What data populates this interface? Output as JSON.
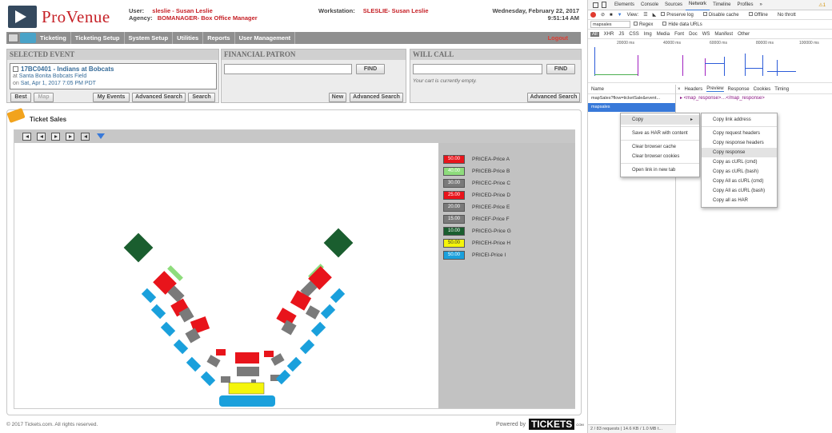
{
  "app": {
    "logo_text": "ProVenue",
    "user_label": "User:",
    "user_value": "sleslie - Susan Leslie",
    "agency_label": "Agency:",
    "agency_value": "BOMANAGER- Box Office Manager",
    "workstation_label": "Workstation:",
    "workstation_value": "SLESLIE- Susan Leslie",
    "date": "Wednesday, February 22, 2017",
    "time": "9:51:14 AM"
  },
  "menu": {
    "items": [
      "Ticketing",
      "Ticketing Setup",
      "System Setup",
      "Utilities",
      "Reports",
      "User Management"
    ],
    "logout": "Logout"
  },
  "selected_event": {
    "title": "SELECTED EVENT",
    "event_line": "17BC0401 - Indians at Bobcats",
    "at_prefix": "at",
    "venue": "Santa Bonita Bobcats Field",
    "on_prefix": "on",
    "datetime": "Sat, Apr 1, 2017 7:05 PM PDT",
    "buttons": [
      "Best",
      "Map",
      "My Events",
      "Advanced Search",
      "Search"
    ]
  },
  "financial_patron": {
    "title": "FINANCIAL PATRON",
    "find": "FIND",
    "new": "New",
    "advanced": "Advanced Search"
  },
  "will_call": {
    "title": "WILL CALL",
    "find": "FIND",
    "cart": "Your cart is currently empty.",
    "advanced": "Advanced Search"
  },
  "ticket_sales": {
    "title": "Ticket Sales",
    "legend": [
      {
        "price": "50.00",
        "label": "PRICEA-Price A",
        "color": "#e8141b"
      },
      {
        "price": "40.00",
        "label": "PRICEB-Price B",
        "color": "#8edc7c"
      },
      {
        "price": "30.00",
        "label": "PRICEC-Price C",
        "color": "#7a7a7a"
      },
      {
        "price": "25.00",
        "label": "PRICED-Price D",
        "color": "#e8141b"
      },
      {
        "price": "20.00",
        "label": "PRICEE-Price E",
        "color": "#7a7a7a"
      },
      {
        "price": "15.00",
        "label": "PRICEF-Price F",
        "color": "#7a7a7a"
      },
      {
        "price": "10.00",
        "label": "PRICEG-Price G",
        "color": "#1a5e2f"
      },
      {
        "price": "50.00",
        "label": "PRICEH-Price H",
        "color": "#f5f50a"
      },
      {
        "price": "50.00",
        "label": "PRICEI-Price I",
        "color": "#1aa0dc"
      }
    ]
  },
  "footer": {
    "copyright": "© 2017 Tickets.com. All rights reserved.",
    "powered_by": "Powered by",
    "brand": "TICKETS",
    "brand_sub": ".COM"
  },
  "devtools": {
    "tabs": [
      "Elements",
      "Console",
      "Sources",
      "Network",
      "Timeline",
      "Profiles",
      "»"
    ],
    "warn": "⚠1",
    "view_label": "View:",
    "preserve_log": "Preserve log",
    "disable_cache": "Disable cache",
    "offline": "Offline",
    "throttle": "No thrott",
    "filter_value": "mapsales",
    "regex": "Regex",
    "hide_data": "Hide data URLs",
    "types": [
      "All",
      "XHR",
      "JS",
      "CSS",
      "Img",
      "Media",
      "Font",
      "Doc",
      "WS",
      "Manifest",
      "Other"
    ],
    "timeline_labels": [
      "20000 ms",
      "40000 ms",
      "60000 ms",
      "80000 ms",
      "100000 ms"
    ],
    "name_header": "Name",
    "requests": [
      "mapSales?flow=ticketSale&event...",
      "mapsales"
    ],
    "detail_tabs": [
      "×",
      "Headers",
      "Preview",
      "Response",
      "Cookies",
      "Timing"
    ],
    "response_preview": "▸ <map_response>…</map_response>",
    "status": "2 / 83 requests | 14.6 KB / 1.0 MB t..."
  },
  "context_menu": {
    "items": [
      "Copy",
      "Save as HAR with content",
      "Clear browser cache",
      "Clear browser cookies",
      "Open link in new tab"
    ],
    "submenu": [
      "Copy link address",
      "Copy request headers",
      "Copy response headers",
      "Copy response",
      "Copy as cURL (cmd)",
      "Copy as cURL (bash)",
      "Copy All as cURL (cmd)",
      "Copy All as cURL (bash)",
      "Copy all as HAR"
    ]
  }
}
